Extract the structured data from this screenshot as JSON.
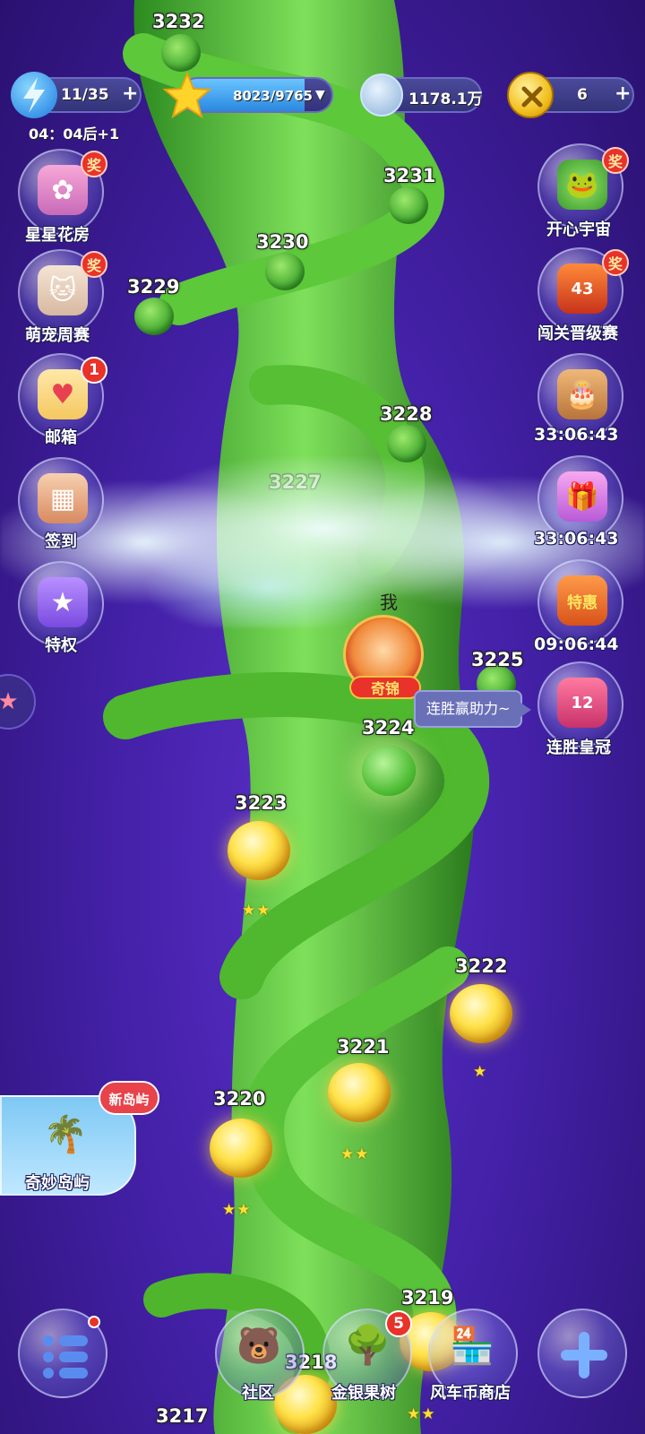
{
  "topbar": {
    "lives": {
      "value": "11/35",
      "plus": "+",
      "timer": "04：04后+1"
    },
    "stars": {
      "value": "8023/9765",
      "progress": 0.82,
      "dropdown": "▼"
    },
    "coins": {
      "value": "1178.1万"
    },
    "gold": {
      "value": "6",
      "plus": "+"
    }
  },
  "left_menu": [
    {
      "label": "星星花房",
      "badge": "奖",
      "icon": "flower-house-icon"
    },
    {
      "label": "萌宠周赛",
      "badge": "奖",
      "icon": "cat-pet-icon"
    },
    {
      "label": "邮箱",
      "badge": "1",
      "icon": "mail-icon"
    },
    {
      "label": "签到",
      "badge": "",
      "icon": "calendar-icon"
    },
    {
      "label": "特权",
      "badge": "",
      "icon": "bird-privilege-icon"
    }
  ],
  "right_menu": [
    {
      "label": "开心宇宙",
      "badge": "奖",
      "icon": "frog-universe-icon"
    },
    {
      "label": "闯关晋级赛",
      "badge": "奖",
      "icon": "rank-shield-icon",
      "rank": "43"
    },
    {
      "label": "33:06:43",
      "badge": "",
      "icon": "bear-cake-icon"
    },
    {
      "label": "33:06:43",
      "badge": "",
      "icon": "gift-box-icon"
    },
    {
      "label": "09:06:44",
      "badge": "",
      "icon": "sale-shop-icon",
      "tag": "特惠"
    },
    {
      "label": "连胜皇冠",
      "badge": "",
      "icon": "crown-streak-icon",
      "count": "12"
    }
  ],
  "levels": {
    "l3232": "3232",
    "l3231": "3231",
    "l3230": "3230",
    "l3229": "3229",
    "l3228": "3228",
    "l3227": "3227",
    "l3225": "3225",
    "l3224": "3224",
    "l3223": "3223",
    "l3222": "3222",
    "l3221": "3221",
    "l3220": "3220",
    "l3219": "3219",
    "l3218": "3218",
    "l3217": "3217"
  },
  "player": {
    "me_label": "我",
    "tag": "奇锦",
    "tooltip": "连胜赢助力~"
  },
  "island": {
    "label": "奇妙岛屿",
    "new_tag": "新岛屿"
  },
  "bottom": {
    "menu_icon": "list-menu-icon",
    "community": "社区",
    "money_tree": "金银果树",
    "money_tree_badge": "5",
    "shop": "风车币商店",
    "add_icon": "plus-icon"
  },
  "colors": {
    "bg": "#4421a8",
    "stalk": "#4cbb32",
    "gold_node": "#ffe24a",
    "badge_red": "#e8322a"
  }
}
